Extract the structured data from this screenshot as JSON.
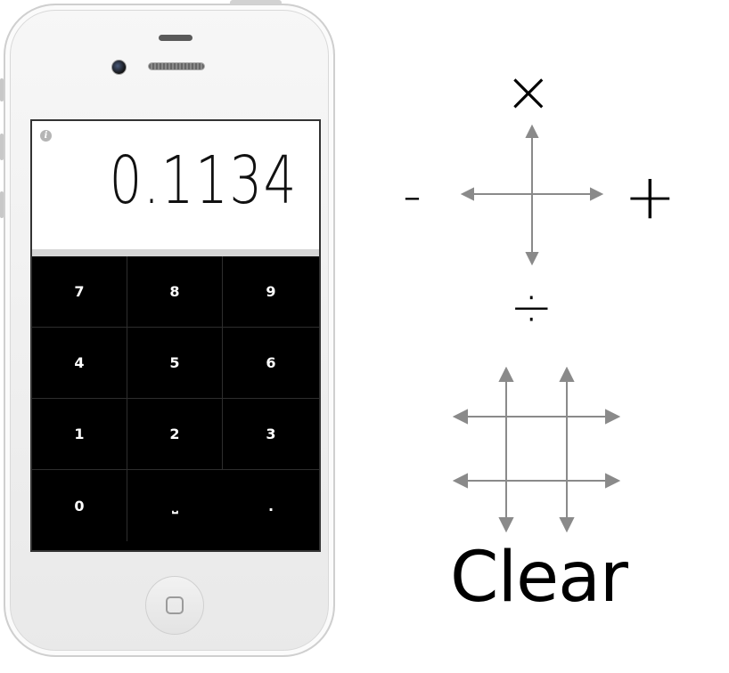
{
  "calculator": {
    "display_value": "0.1134",
    "info_icon": "i",
    "keys": [
      "7",
      "8",
      "9",
      "4",
      "5",
      "6",
      "1",
      "2",
      "3",
      "0",
      "⎵",
      "."
    ]
  },
  "legend": {
    "multiply_symbol": "×",
    "minus_symbol": "-",
    "plus_symbol": "+",
    "divide_symbol": "÷",
    "clear_label": "Clear"
  },
  "icons": {
    "info": "info-icon",
    "home": "home-button-icon",
    "cross_arrows": "four-way-arrows-icon",
    "hash_arrows": "double-four-way-arrows-icon"
  }
}
